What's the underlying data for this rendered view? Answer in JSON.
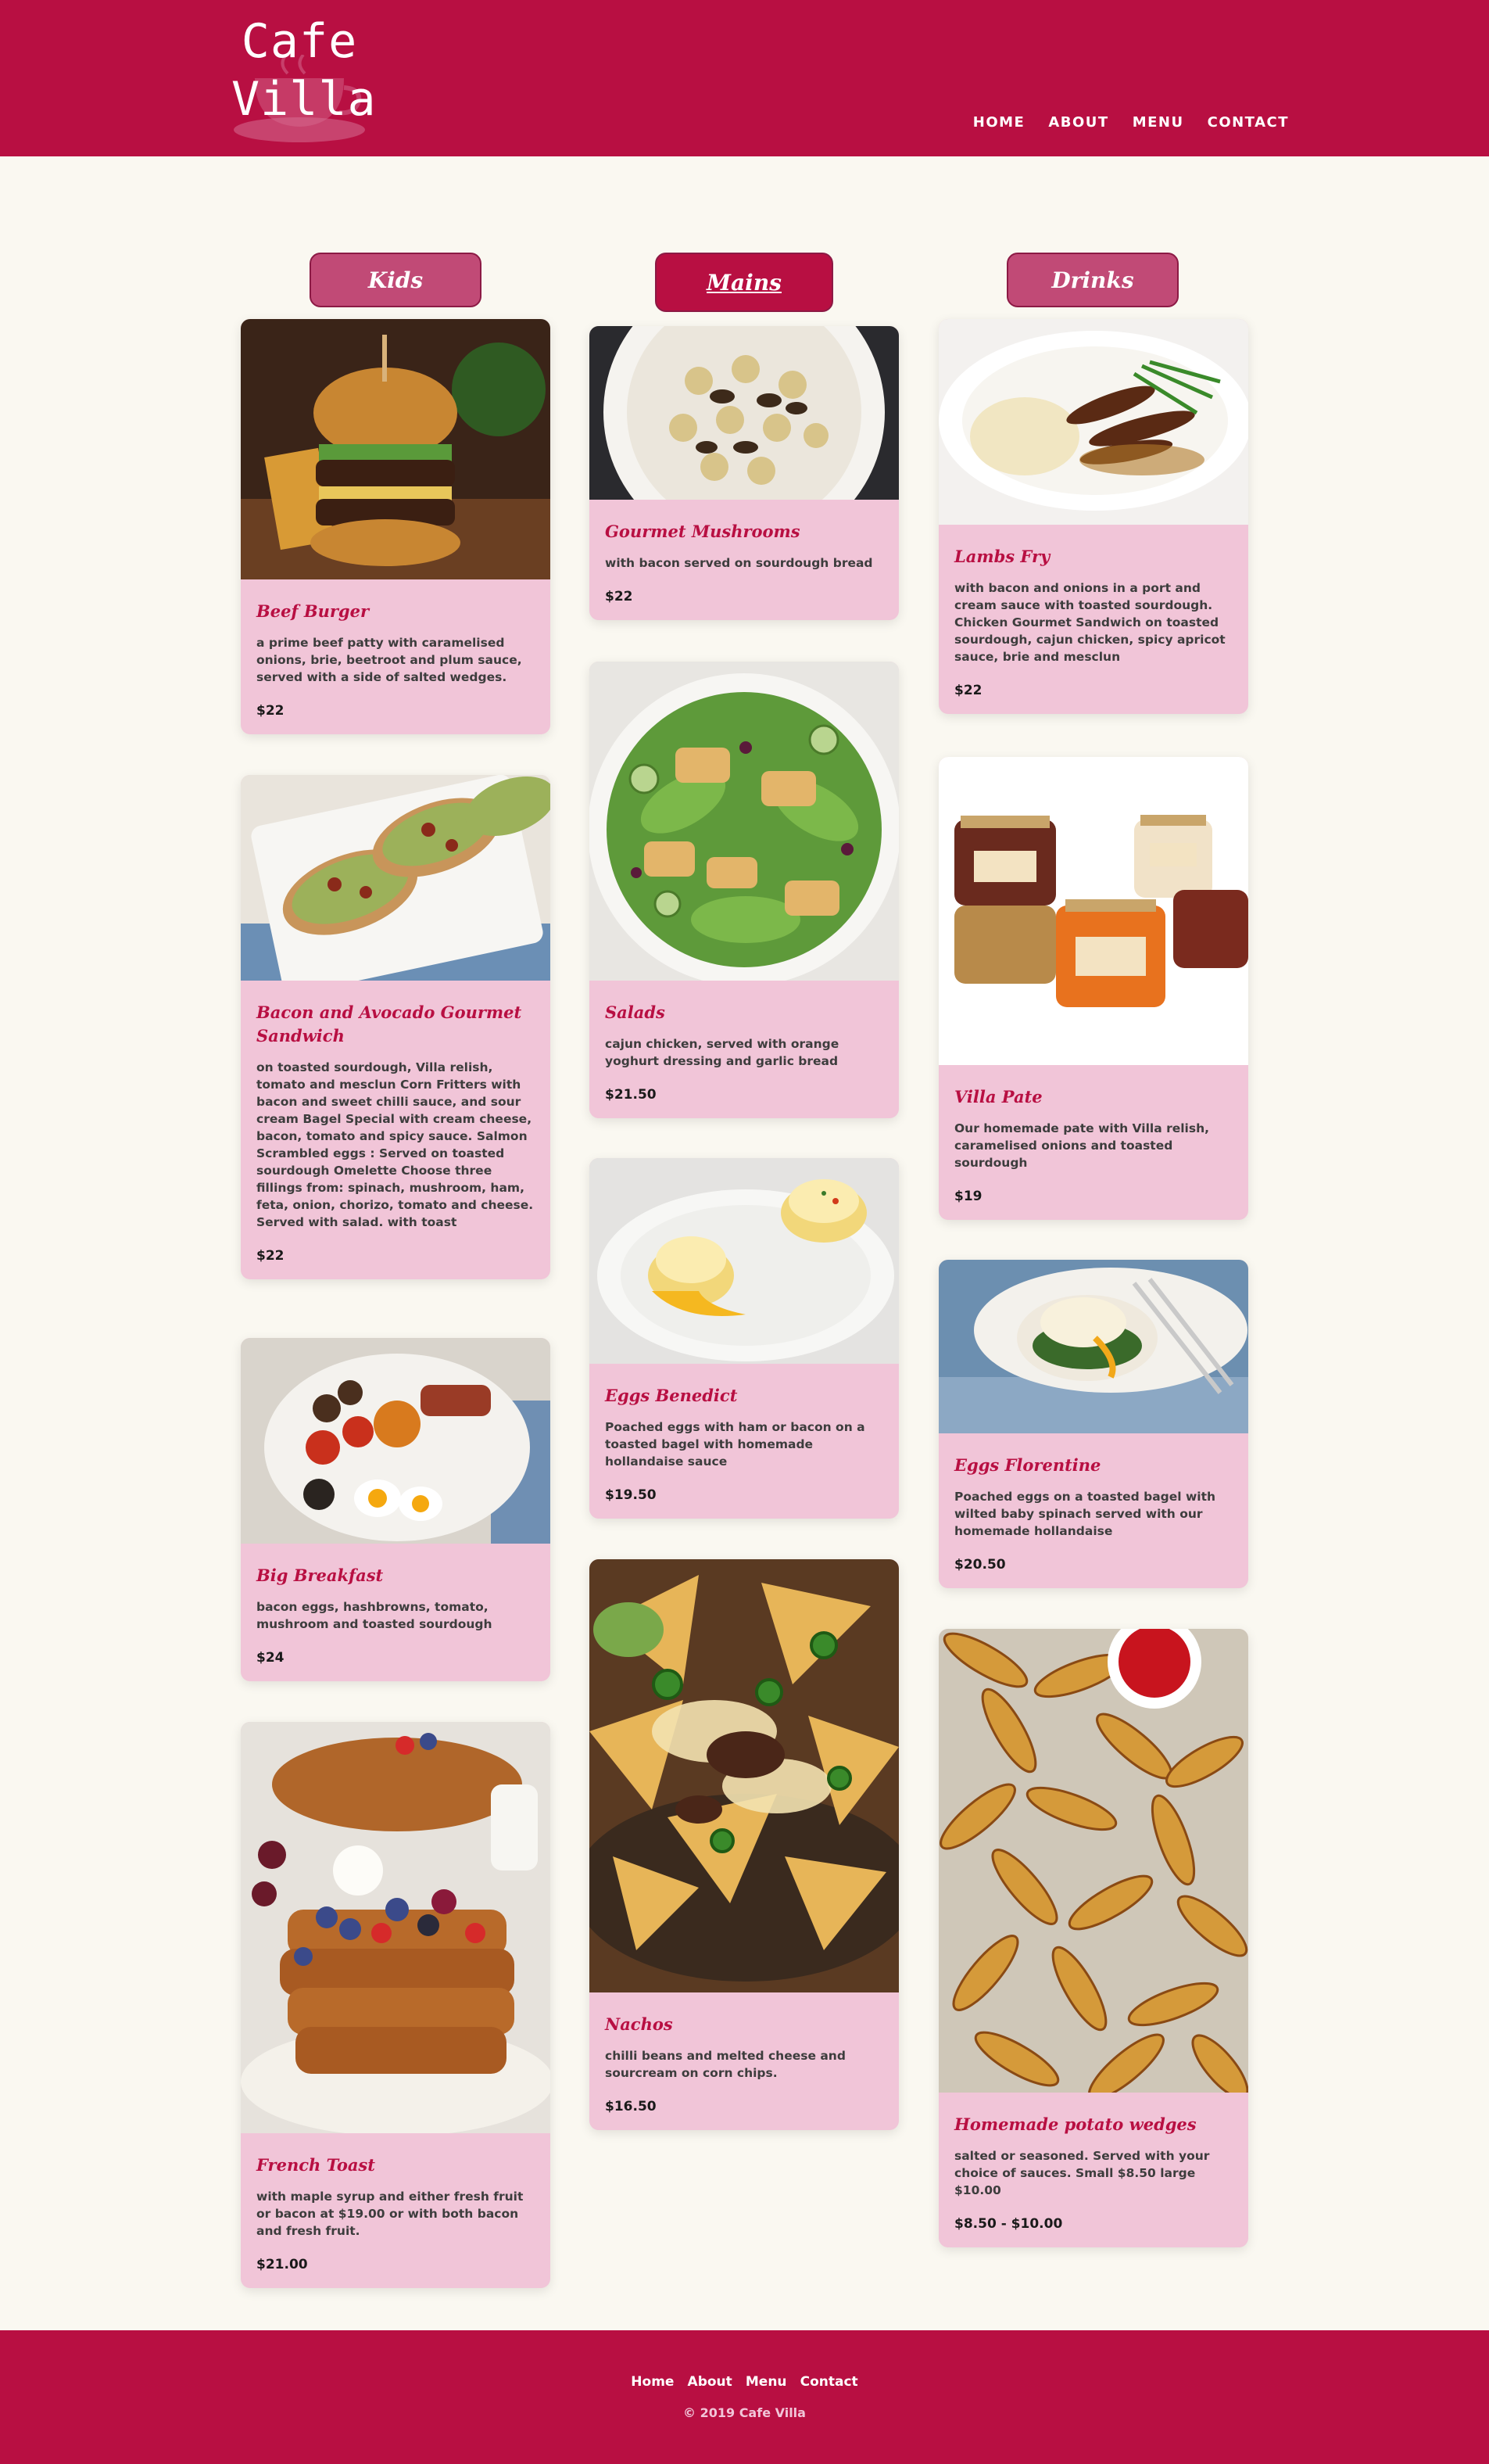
{
  "header": {
    "logo_line1": "Cafe",
    "logo_line2": "Villa",
    "nav": [
      "HOME",
      "ABOUT",
      "MENU",
      "CONTACT"
    ]
  },
  "tabs": {
    "kids": "Kids",
    "mains": "Mains",
    "drinks": "Drinks"
  },
  "colors": {
    "brand": "#b80f42",
    "card": "#f1c5d8",
    "page_bg": "#faf8f1",
    "tab_inactive": "#c14a76"
  },
  "kids": [
    {
      "name": "Beef Burger",
      "desc": "a prime beef patty with caramelised onions, brie, beetroot and plum sauce, served with a side of salted wedges.",
      "price": "$22",
      "image": "beef-burger-photo"
    },
    {
      "name": "Bacon and Avocado Gourmet Sandwich",
      "desc": "on toasted sourdough, Villa relish, tomato and mesclun Corn Fritters with bacon and sweet chilli sauce, and sour cream Bagel Special with cream cheese, bacon, tomato and spicy sauce. Salmon Scrambled eggs : Served on toasted sourdough Omelette Choose three fillings from: spinach, mushroom, ham, feta, onion, chorizo, tomato and cheese. Served with salad. with toast",
      "price": "$22",
      "image": "avocado-toast-photo"
    },
    {
      "name": "Big Breakfast",
      "desc": "bacon eggs, hashbrowns, tomato, mushroom and toasted sourdough",
      "price": "$24",
      "image": "big-breakfast-photo"
    },
    {
      "name": "French Toast",
      "desc": "with maple syrup and either fresh fruit or bacon at $19.00 or with both bacon and fresh fruit.",
      "price": "$21.00",
      "image": "french-toast-photo"
    }
  ],
  "mains": [
    {
      "name": "Gourmet Mushrooms",
      "desc": "with bacon served on sourdough bread",
      "price": "$22",
      "image": "mushroom-pasta-photo"
    },
    {
      "name": "Salads",
      "desc": "cajun chicken, served with orange yoghurt dressing and garlic bread",
      "price": "$21.50",
      "image": "halloumi-salad-photo"
    },
    {
      "name": "Eggs Benedict",
      "desc": "Poached eggs with ham or bacon on a toasted bagel with homemade hollandaise sauce",
      "price": "$19.50",
      "image": "eggs-benedict-photo"
    },
    {
      "name": "Nachos",
      "desc": "chilli beans and melted cheese and sourcream on corn chips.",
      "price": "$16.50",
      "image": "nachos-photo"
    }
  ],
  "drinks": [
    {
      "name": "Lambs Fry",
      "desc": "with bacon and onions in a port and cream sauce with toasted sourdough. Chicken Gourmet Sandwich on toasted sourdough, cajun chicken, spicy apricot sauce, brie and mesclun",
      "price": "$22",
      "image": "lambs-fry-photo"
    },
    {
      "name": "Villa Pate",
      "desc": "Our homemade pate with Villa relish, caramelised onions and toasted sourdough",
      "price": "$19",
      "image": "pate-jars-photo"
    },
    {
      "name": "Eggs Florentine",
      "desc": "Poached eggs on a toasted bagel with wilted baby spinach served with our homemade hollandaise",
      "price": "$20.50",
      "image": "eggs-florentine-photo"
    },
    {
      "name": "Homemade potato wedges",
      "desc": "salted or seasoned. Served with your choice of sauces. Small $8.50 large $10.00",
      "price": "$8.50 - $10.00",
      "image": "potato-wedges-photo"
    }
  ],
  "footer": {
    "links": [
      "Home",
      "About",
      "Menu",
      "Contact"
    ],
    "copyright": "© 2019 Cafe Villa"
  }
}
